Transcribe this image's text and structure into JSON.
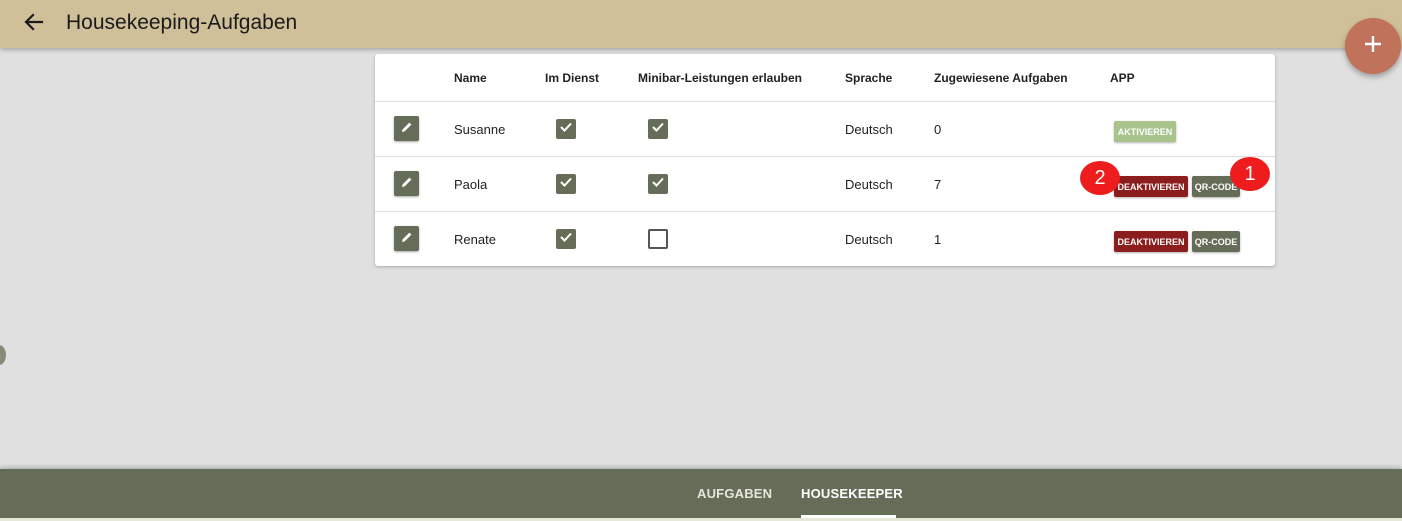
{
  "header": {
    "title": "Housekeeping-Aufgaben",
    "back_icon": "arrow-left-icon",
    "add_icon": "plus-icon"
  },
  "table": {
    "columns": {
      "name": "Name",
      "on_duty": "Im Dienst",
      "minibar": "Minibar-Leistungen erlauben",
      "language": "Sprache",
      "assigned": "Zugewiesene Aufgaben",
      "app": "APP"
    },
    "rows": [
      {
        "name": "Susanne",
        "on_duty": true,
        "minibar": true,
        "language": "Deutsch",
        "assigned": "0",
        "actions": [
          "AKTIVIEREN"
        ]
      },
      {
        "name": "Paola",
        "on_duty": true,
        "minibar": true,
        "language": "Deutsch",
        "assigned": "7",
        "actions": [
          "DEAKTIVIEREN",
          "QR-CODE"
        ]
      },
      {
        "name": "Renate",
        "on_duty": true,
        "minibar": false,
        "language": "Deutsch",
        "assigned": "1",
        "actions": [
          "DEAKTIVIEREN",
          "QR-CODE"
        ]
      }
    ]
  },
  "annotations": {
    "badge_1": "1",
    "badge_2": "2"
  },
  "bottom_nav": {
    "tabs": [
      {
        "label": "AUFGABEN",
        "active": false
      },
      {
        "label": "HOUSEKEEPER",
        "active": true
      }
    ]
  },
  "colors": {
    "appbar": "#d0c09a",
    "primary": "#656d58",
    "fab": "#c0735a",
    "deactivate": "#8b1d1d",
    "activate": "#a8c48c",
    "badge": "#ee1c1c"
  }
}
